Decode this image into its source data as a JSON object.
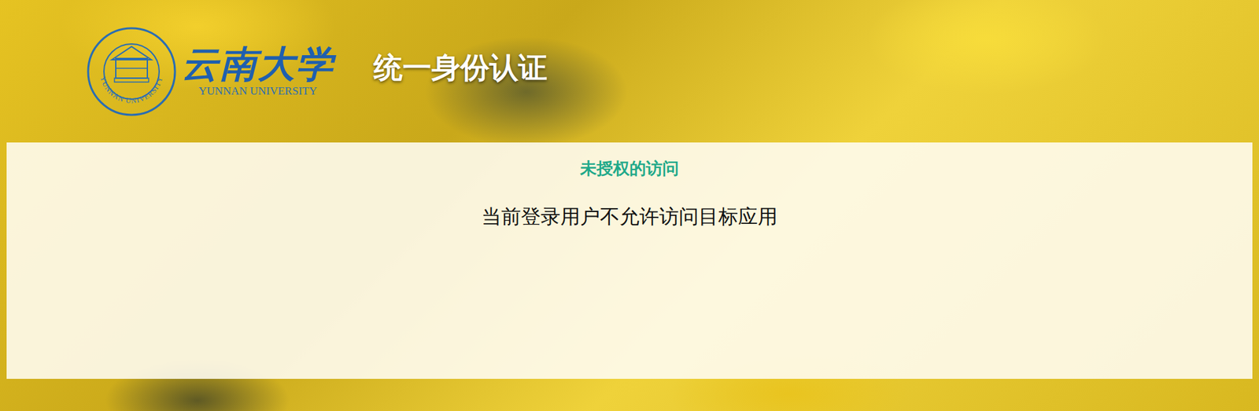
{
  "logo": {
    "emblem_text": "YUNNAN UNIVERSITY",
    "name": "云南大学",
    "name_en": "YUNNAN UNIVERSITY"
  },
  "header": {
    "title": "统一身份认证"
  },
  "message": {
    "heading": "未授权的访问",
    "text": "当前登录用户不允许访问目标应用"
  }
}
